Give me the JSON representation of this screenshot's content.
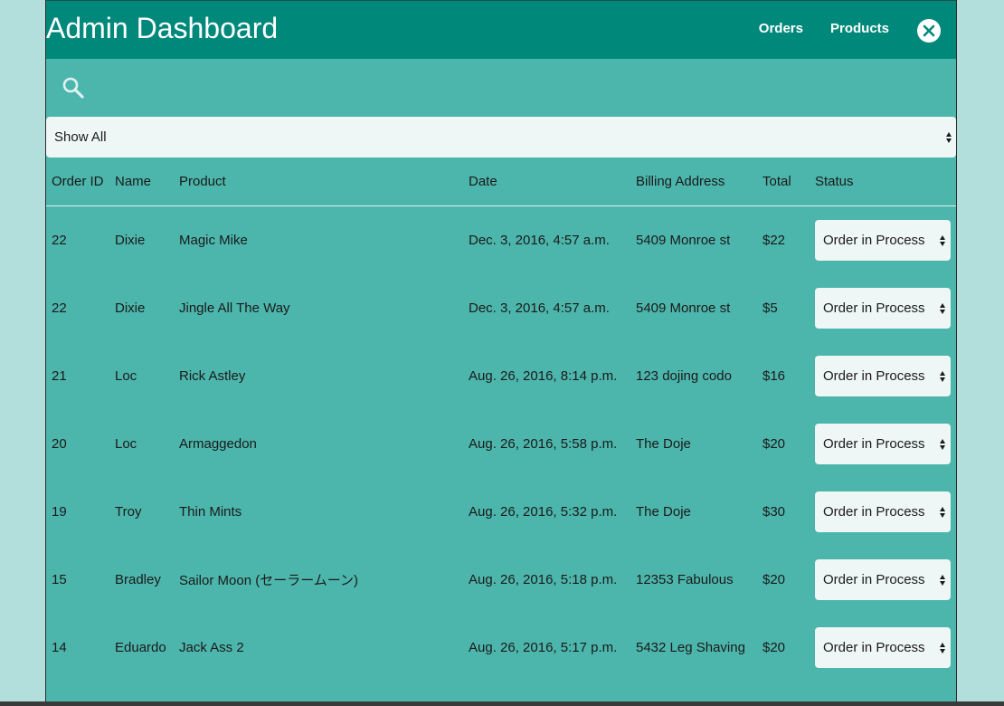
{
  "header": {
    "title": "Admin Dashboard",
    "nav": [
      {
        "label": "Orders"
      },
      {
        "label": "Products"
      }
    ]
  },
  "filter": {
    "selected": "Show All"
  },
  "table": {
    "columns": [
      "Order ID",
      "Name",
      "Product",
      "Date",
      "Billing Address",
      "Total",
      "Status"
    ],
    "rows": [
      {
        "id": "22",
        "name": "Dixie",
        "product": "Magic Mike",
        "date": "Dec. 3, 2016, 4:57 a.m.",
        "address": "5409 Monroe st",
        "total": "$22",
        "status": "Order in Process"
      },
      {
        "id": "22",
        "name": "Dixie",
        "product": "Jingle All The Way",
        "date": "Dec. 3, 2016, 4:57 a.m.",
        "address": "5409 Monroe st",
        "total": "$5",
        "status": "Order in Process"
      },
      {
        "id": "21",
        "name": "Loc",
        "product": "Rick Astley",
        "date": "Aug. 26, 2016, 8:14 p.m.",
        "address": "123 dojing codo",
        "total": "$16",
        "status": "Order in Process"
      },
      {
        "id": "20",
        "name": "Loc",
        "product": "Armaggedon",
        "date": "Aug. 26, 2016, 5:58 p.m.",
        "address": "The Doje",
        "total": "$20",
        "status": "Order in Process"
      },
      {
        "id": "19",
        "name": "Troy",
        "product": "Thin Mints",
        "date": "Aug. 26, 2016, 5:32 p.m.",
        "address": "The Doje",
        "total": "$30",
        "status": "Order in Process"
      },
      {
        "id": "15",
        "name": "Bradley",
        "product": "Sailor Moon (セーラームーン)",
        "date": "Aug. 26, 2016, 5:18 p.m.",
        "address": "12353 Fabulous",
        "total": "$20",
        "status": "Order in Process"
      },
      {
        "id": "14",
        "name": "Eduardo",
        "product": "Jack Ass 2",
        "date": "Aug. 26, 2016, 5:17 p.m.",
        "address": "5432 Leg Shaving",
        "total": "$20",
        "status": "Order in Process"
      }
    ]
  },
  "colors": {
    "background": "#b2dfdb",
    "header": "#00897b",
    "panel": "#4db6ac",
    "select": "#eef7f6"
  }
}
